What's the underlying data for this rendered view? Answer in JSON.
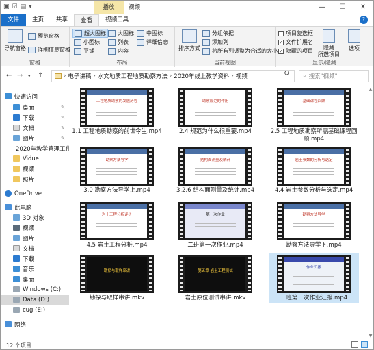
{
  "window": {
    "tools_tab": "播放",
    "title": "视频",
    "controls": [
      "—",
      "☐",
      "✕"
    ]
  },
  "ribbon_tabs": [
    "文件",
    "主页",
    "共享",
    "查看",
    "视频工具"
  ],
  "ribbon": {
    "panes": {
      "nav_pane": "导航窗格",
      "preview_pane": "预览窗格",
      "details_pane": "详细信息窗格",
      "label": "窗格"
    },
    "layout": {
      "extra_large": "超大图标",
      "large": "大图标",
      "medium": "中图标",
      "small": "小图标",
      "list": "列表",
      "details": "详细信息",
      "tiles": "平铺",
      "content": "内容",
      "label": "布局"
    },
    "current_view": {
      "sort": "排序方式",
      "group_by": "分组依据",
      "add_columns": "添加列",
      "size_all_columns": "将所有列调整为合适的大小",
      "label": "当前视图"
    },
    "show_hide": {
      "item_checkboxes": "项目复选框",
      "file_extensions": "文件扩展名",
      "hidden_items": "隐藏的项目",
      "hide_selected": "隐藏\n所选项目",
      "options": "选项",
      "label": "显示/隐藏"
    }
  },
  "address": {
    "crumbs": [
      "电子讲稿",
      "水文地质工程地质勘察方法",
      "2020年线上教学资料",
      "视频"
    ],
    "search_placeholder": "搜索\"视频\""
  },
  "nav": {
    "quick_access": "快速访问",
    "quick_items": [
      "桌面",
      "下载",
      "文档",
      "图片",
      "2020年教学管理工作",
      "Vidue",
      "视频",
      "照片"
    ],
    "onedrive": "OneDrive",
    "this_pc": "此电脑",
    "pc_items": [
      "3D 对象",
      "视频",
      "图片",
      "文档",
      "下载",
      "音乐",
      "桌面",
      "Windows (C:)",
      "Data (D:)",
      "cug (E:)"
    ],
    "network": "网络"
  },
  "files": [
    {
      "name": "1.1 工程地质勘察的前世今生.mp4",
      "slide_title": "工程地质勘察的发展历程"
    },
    {
      "name": "2.4 规范为什么很重要.mp4",
      "slide_title": "勘察规范的作用"
    },
    {
      "name": "2.5 工程地质勘察所需基础课程回顾.mp4",
      "slide_title": "基础课程回顾"
    },
    {
      "name": "3.0 勘察方法导学上.mp4",
      "slide_title": "勘察方法导学"
    },
    {
      "name": "3.2.6 结构面测量及统计.mp4",
      "slide_title": "结构面测量及统计"
    },
    {
      "name": "4.4 岩土参数分析与选定.mp4",
      "slide_title": "岩土参数的分析与选定"
    },
    {
      "name": "4.5 岩土工程分析.mp4",
      "slide_title": "岩土工程分析评价"
    },
    {
      "name": "二班第一次作业.mp4",
      "slide_title": "第一次作业"
    },
    {
      "name": "勘察方法导学下.mp4",
      "slide_title": "勘察方法导学"
    },
    {
      "name": "勘探与取样串讲.mkv",
      "slide_title": "勘探与取样串讲"
    },
    {
      "name": "岩土原位测试串讲.mkv",
      "slide_title": "第五章 岩土工程测试"
    },
    {
      "name": "一班第一次作业汇报.mp4",
      "slide_title": "作业汇报"
    }
  ],
  "status": {
    "count": "12 个项目"
  },
  "colors": {
    "accent": "#1a6fc9",
    "selection": "#cce4f7",
    "tools_tab": "#f5e6a8"
  }
}
